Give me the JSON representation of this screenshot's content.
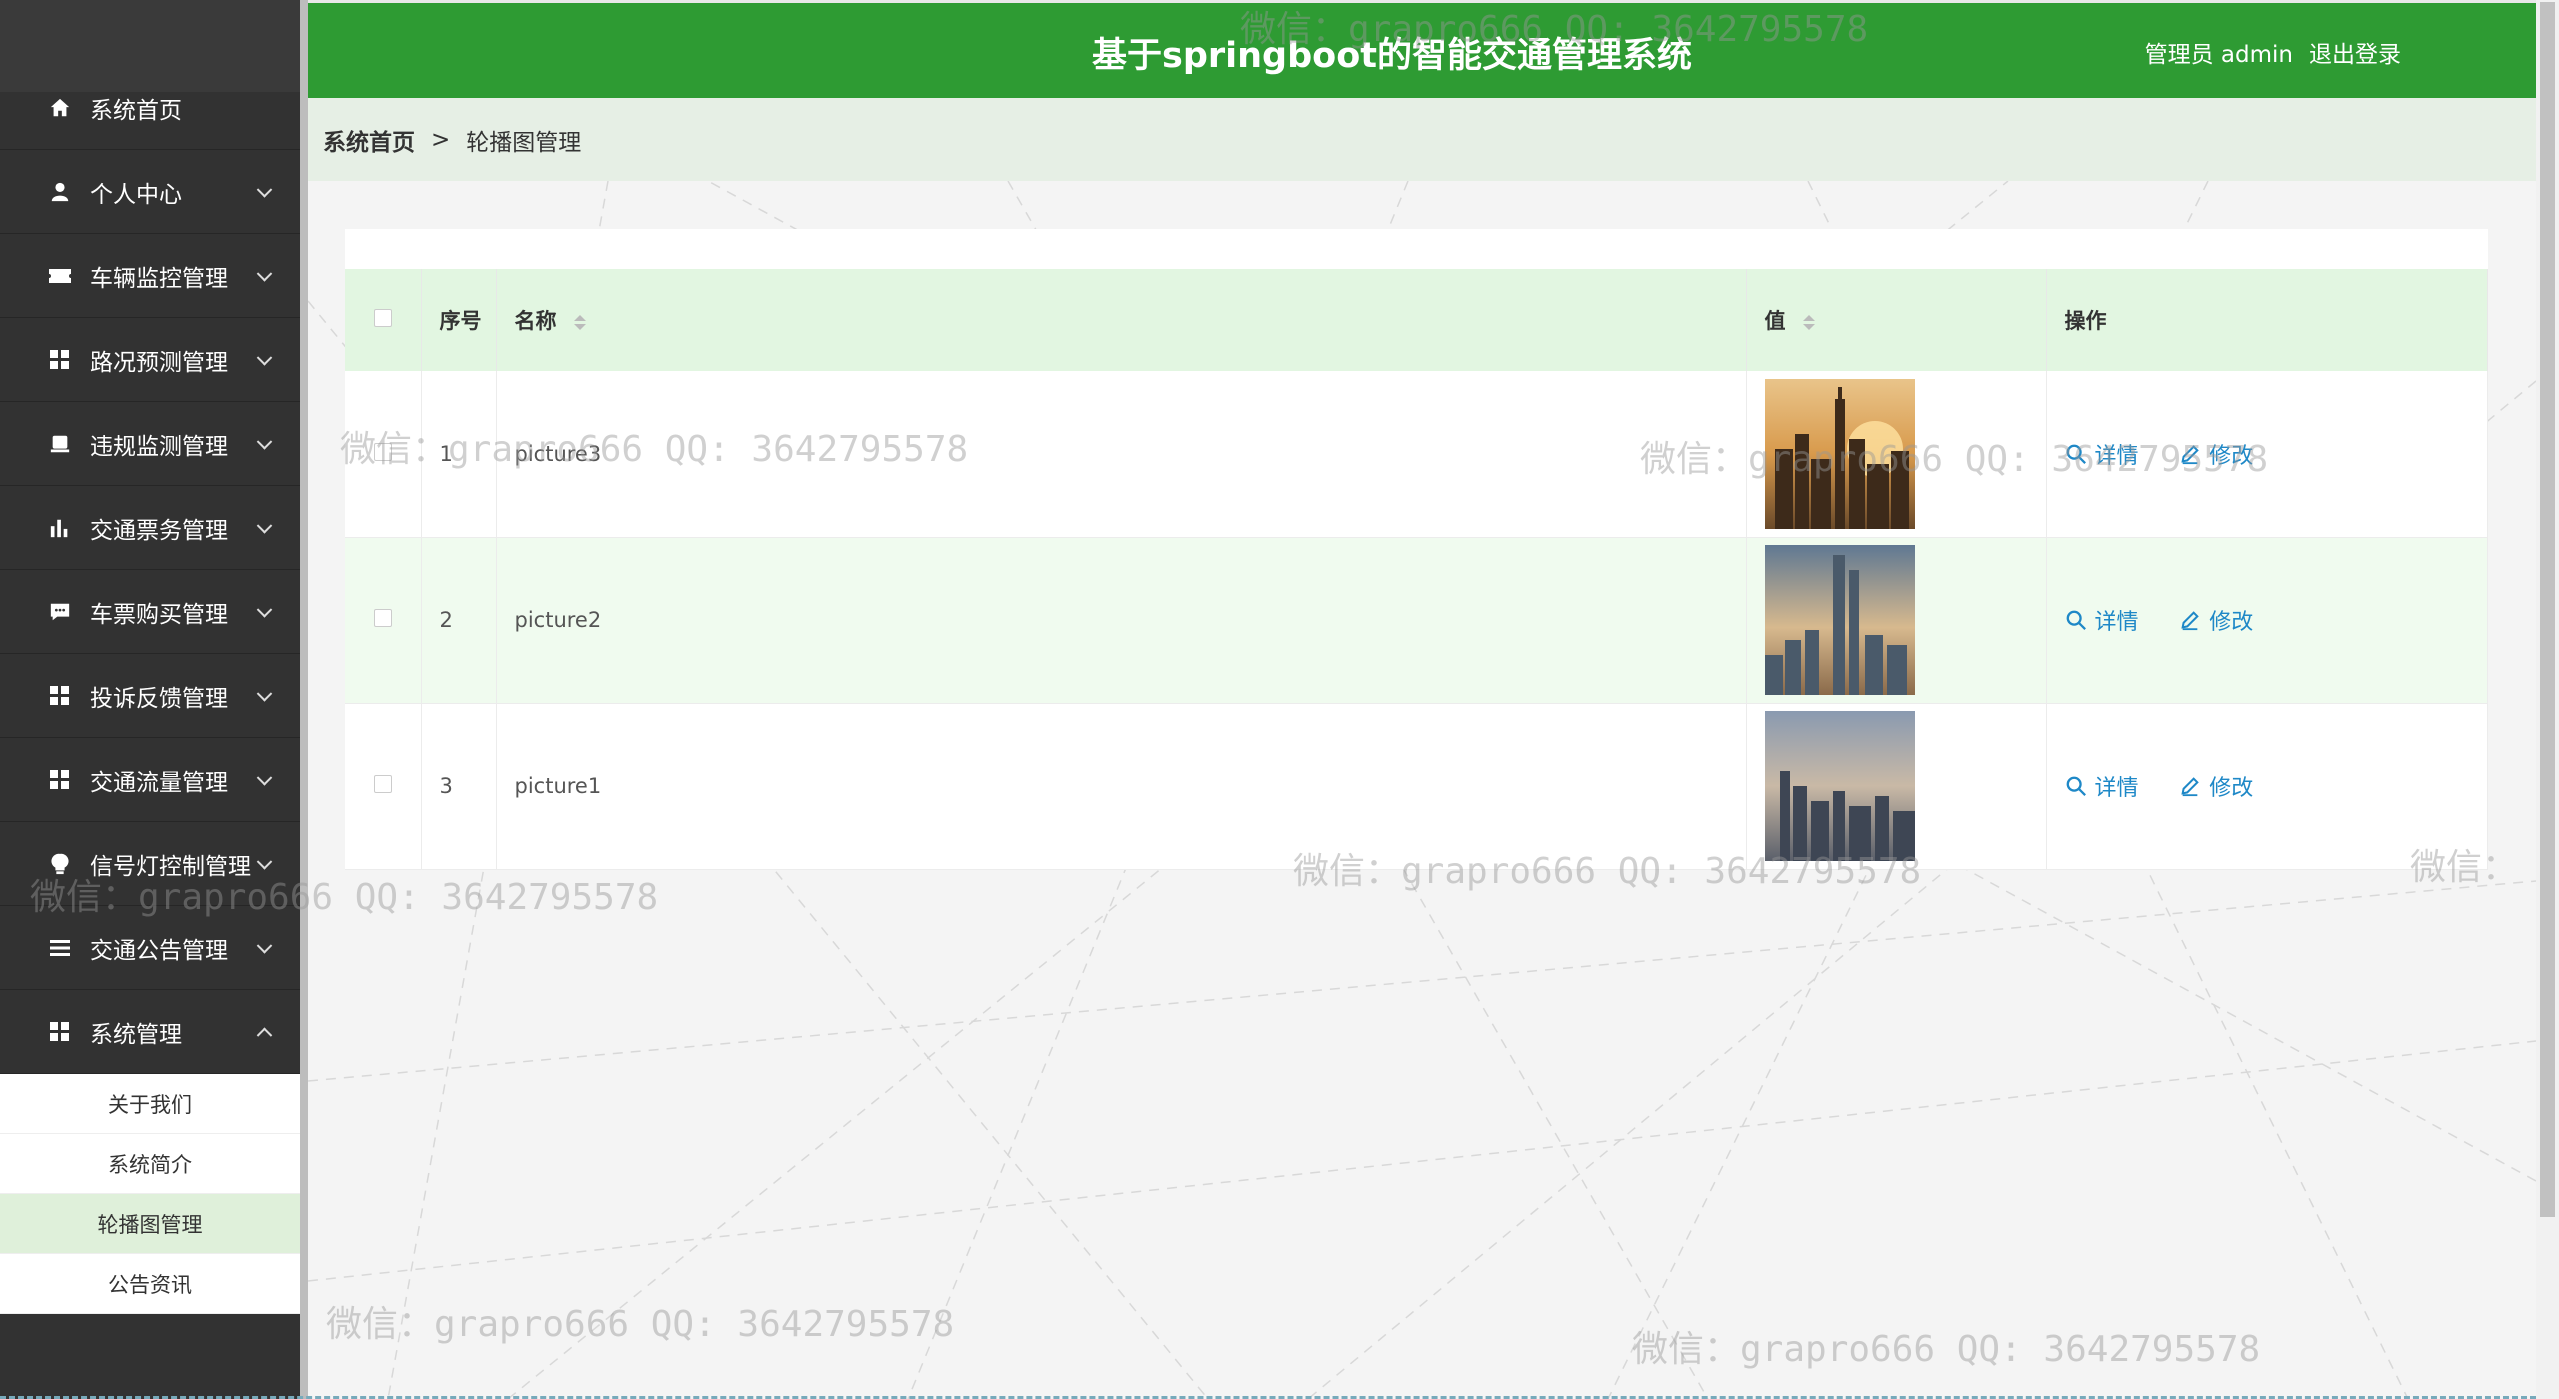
{
  "header": {
    "title": "基于springboot的智能交通管理系统",
    "user_label": "管理员 admin",
    "logout": "退出登录"
  },
  "breadcrumb": {
    "home": "系统首页",
    "separator": ">",
    "current": "轮播图管理"
  },
  "sidebar": {
    "items": [
      {
        "label": "系统首页",
        "icon": "home-icon"
      },
      {
        "label": "个人中心",
        "icon": "user-icon"
      },
      {
        "label": "车辆监控管理",
        "icon": "ticket-icon"
      },
      {
        "label": "路况预测管理",
        "icon": "grid-icon"
      },
      {
        "label": "违规监测管理",
        "icon": "monitor-icon"
      },
      {
        "label": "交通票务管理",
        "icon": "bar-chart-icon"
      },
      {
        "label": "车票购买管理",
        "icon": "chat-icon"
      },
      {
        "label": "投诉反馈管理",
        "icon": "grid-icon"
      },
      {
        "label": "交通流量管理",
        "icon": "grid-icon"
      },
      {
        "label": "信号灯控制管理",
        "icon": "bulb-icon"
      },
      {
        "label": "交通公告管理",
        "icon": "list-icon"
      },
      {
        "label": "系统管理",
        "icon": "grid-icon"
      }
    ],
    "submenu": [
      {
        "label": "关于我们"
      },
      {
        "label": "系统简介"
      },
      {
        "label": "轮播图管理"
      },
      {
        "label": "公告资讯"
      }
    ]
  },
  "table": {
    "columns": {
      "index": "序号",
      "name": "名称",
      "value": "值",
      "actions": "操作"
    },
    "rows": [
      {
        "index": "1",
        "name": "picture3",
        "detail": "详情",
        "edit": "修改"
      },
      {
        "index": "2",
        "name": "picture2",
        "detail": "详情",
        "edit": "修改"
      },
      {
        "index": "3",
        "name": "picture1",
        "detail": "详情",
        "edit": "修改"
      }
    ]
  },
  "watermark": "微信：grapro666 QQ: 3642795578",
  "colors": {
    "header_bg": "#2e9b33",
    "sidebar_bg": "#323232",
    "table_header_bg": "#e2f6e1",
    "link": "#1e88c7"
  }
}
